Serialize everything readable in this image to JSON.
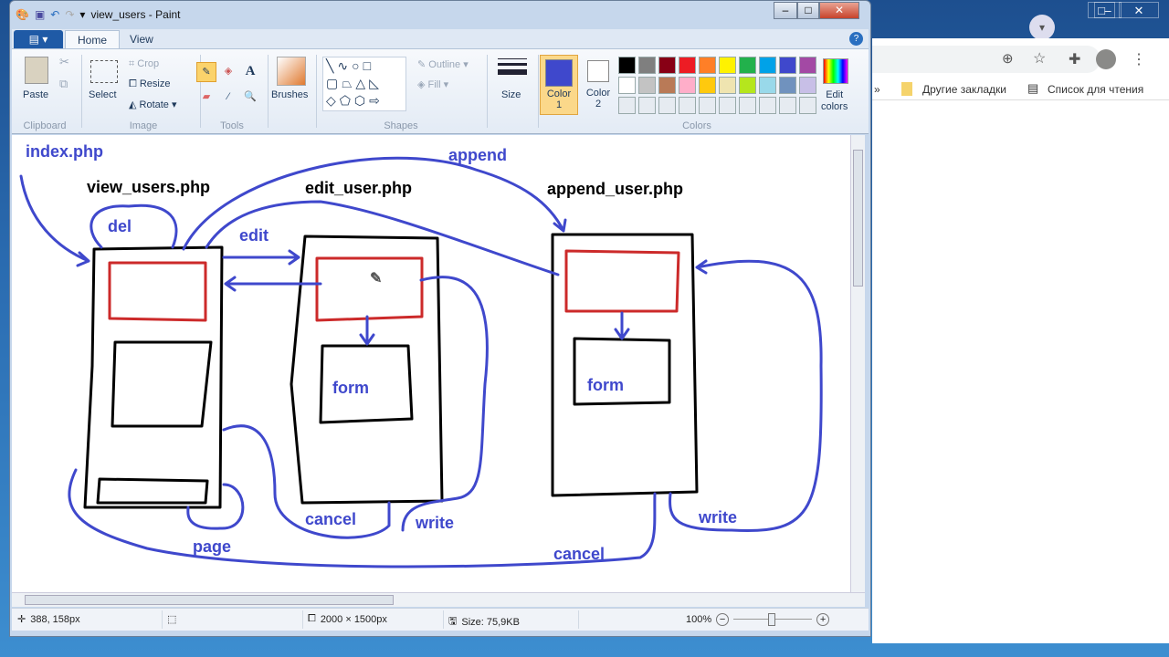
{
  "window": {
    "title": "view_users - Paint",
    "minimize": "–",
    "maximize": "□",
    "close": "✕"
  },
  "menu": {
    "file": "▤ ▾",
    "tabs": [
      {
        "label": "Home"
      },
      {
        "label": "View"
      }
    ],
    "help": "?"
  },
  "ribbon": {
    "clipboard": {
      "label": "Clipboard",
      "paste": "Paste"
    },
    "image": {
      "label": "Image",
      "select": "Select",
      "crop": "Crop",
      "resize": "Resize",
      "rotate": "Rotate"
    },
    "tools": {
      "label": "Tools"
    },
    "brushes": "Brushes",
    "shapes": {
      "label": "Shapes",
      "outline": "Outline",
      "fill": "Fill"
    },
    "size": "Size",
    "colors": {
      "label": "Colors",
      "color1": "Color",
      "color1_num": "1",
      "color2": "Color",
      "color2_num": "2",
      "edit": "Edit",
      "edit2": "colors",
      "active_color": "#3f48cc",
      "palette": [
        "#000000",
        "#7f7f7f",
        "#880015",
        "#ed1c24",
        "#ff7f27",
        "#fff200",
        "#22b14c",
        "#00a2e8",
        "#3f48cc",
        "#a349a4",
        "#ffffff",
        "#c3c3c3",
        "#b97a57",
        "#ffaec9",
        "#ffc90e",
        "#efe4b0",
        "#b5e61d",
        "#99d9ea",
        "#7092be",
        "#c8bfe7"
      ]
    }
  },
  "drawing": {
    "files": [
      "index.php",
      "view_users.php",
      "edit_user.php",
      "append_user.php"
    ],
    "labels": {
      "append": "append",
      "del": "del",
      "edit": "edit",
      "form1": "form",
      "form2": "form",
      "cancel1": "cancel",
      "write1": "write",
      "page": "page",
      "cancel2": "cancel",
      "write2": "write"
    },
    "ink": "#3f48cc"
  },
  "status": {
    "cursor": "388, 158px",
    "dimensions": "2000 × 1500px",
    "size": "Size: 75,9KB",
    "zoom": "100%"
  },
  "browser": {
    "bookmarks": [
      "Другие закладки",
      "Список для чтения"
    ],
    "more": "»"
  }
}
